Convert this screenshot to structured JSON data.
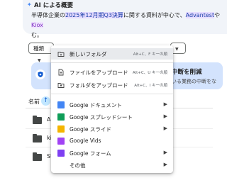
{
  "ai_overview": {
    "title": "AI による概要",
    "line1_before": "半導体企業の",
    "line1_highlight": "2025年12月期Q3決算",
    "line1_after": "に関する資料が中心で、",
    "line1_brand1": "Advantest",
    "line1_mid": "や",
    "line1_brand2": "Kiox",
    "line2": "む。"
  },
  "filters": {
    "type_chip": "種類"
  },
  "promo": {
    "title": "中断を削減",
    "subtitle": "いる業務の中断をな"
  },
  "file_list": {
    "name_header": "名前",
    "rows": [
      {
        "name": "A"
      },
      {
        "name": "ki"
      },
      {
        "name": "St"
      }
    ]
  },
  "menu": {
    "items": [
      {
        "label": "新しいフォルダ",
        "shortcut": "Alt+C、F キーの順",
        "icon": "new-folder-icon"
      },
      {
        "label": "ファイルをアップロード",
        "shortcut": "Alt+C、U キーの順",
        "icon": "file-upload-icon"
      },
      {
        "label": "フォルダをアップロード",
        "shortcut": "Alt+C、I キーの順",
        "icon": "folder-upload-icon"
      },
      {
        "label": "Google ドキュメント",
        "icon": "google-docs-icon"
      },
      {
        "label": "Google スプレッドシート",
        "icon": "google-sheets-icon"
      },
      {
        "label": "Google スライド",
        "icon": "google-slides-icon"
      },
      {
        "label": "Google Vids",
        "icon": "google-vids-icon"
      },
      {
        "label": "Google フォーム",
        "icon": "google-forms-icon"
      },
      {
        "label": "その他",
        "icon": "more-icon"
      }
    ]
  },
  "colors": {
    "menu_selected": "#e8eaed",
    "promo_bg": "#d3e3fd",
    "accent": "#0b57d0"
  }
}
